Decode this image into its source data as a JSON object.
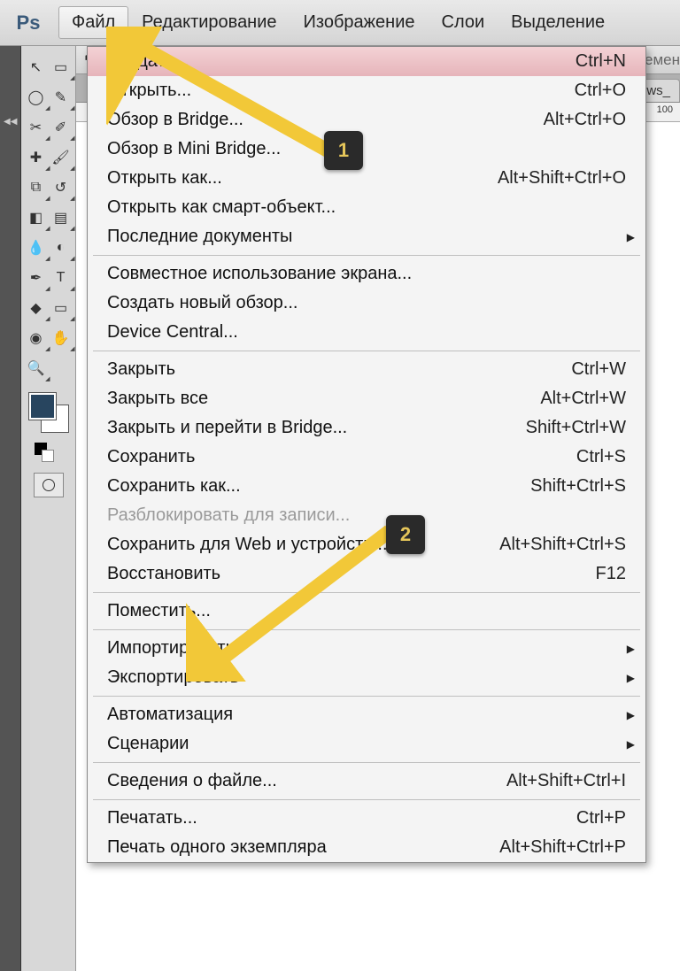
{
  "app": {
    "logo_text": "Ps"
  },
  "menubar": {
    "file": "Файл",
    "edit": "Редактирование",
    "image": "Изображение",
    "layer": "Слои",
    "select": "Выделение"
  },
  "options_hint": "емен",
  "tab_label": "ws_",
  "ruler_mark": "100",
  "file_menu": {
    "create": {
      "label": "Создать...",
      "shortcut": "Ctrl+N"
    },
    "open": {
      "label": "Открыть...",
      "shortcut": "Ctrl+O"
    },
    "browse_bridge": {
      "label": "Обзор в Bridge...",
      "shortcut": "Alt+Ctrl+O"
    },
    "browse_mini": {
      "label": "Обзор в Mini Bridge...",
      "shortcut": ""
    },
    "open_as": {
      "label": "Открыть как...",
      "shortcut": "Alt+Shift+Ctrl+O"
    },
    "open_smart": {
      "label": "Открыть как смарт-объект...",
      "shortcut": ""
    },
    "recent": {
      "label": "Последние документы",
      "shortcut": ""
    },
    "share_screen": {
      "label": "Совместное использование экрана...",
      "shortcut": ""
    },
    "new_review": {
      "label": "Создать новый обзор...",
      "shortcut": ""
    },
    "device_central": {
      "label": "Device Central...",
      "shortcut": ""
    },
    "close": {
      "label": "Закрыть",
      "shortcut": "Ctrl+W"
    },
    "close_all": {
      "label": "Закрыть все",
      "shortcut": "Alt+Ctrl+W"
    },
    "close_bridge": {
      "label": "Закрыть и перейти в Bridge...",
      "shortcut": "Shift+Ctrl+W"
    },
    "save": {
      "label": "Сохранить",
      "shortcut": "Ctrl+S"
    },
    "save_as": {
      "label": "Сохранить как...",
      "shortcut": "Shift+Ctrl+S"
    },
    "unlock_write": {
      "label": "Разблокировать для записи...",
      "shortcut": ""
    },
    "save_web": {
      "label": "Сохранить для Web и устройств...",
      "shortcut": "Alt+Shift+Ctrl+S"
    },
    "revert": {
      "label": "Восстановить",
      "shortcut": "F12"
    },
    "place": {
      "label": "Поместить...",
      "shortcut": ""
    },
    "import": {
      "label": "Импортировать",
      "shortcut": ""
    },
    "export": {
      "label": "Экспортировать",
      "shortcut": ""
    },
    "automate": {
      "label": "Автоматизация",
      "shortcut": ""
    },
    "scripts": {
      "label": "Сценарии",
      "shortcut": ""
    },
    "file_info": {
      "label": "Сведения о файле...",
      "shortcut": "Alt+Shift+Ctrl+I"
    },
    "print": {
      "label": "Печатать...",
      "shortcut": "Ctrl+P"
    },
    "print_one": {
      "label": "Печать одного экземпляра",
      "shortcut": "Alt+Shift+Ctrl+P"
    }
  },
  "annotations": {
    "one": "1",
    "two": "2"
  }
}
